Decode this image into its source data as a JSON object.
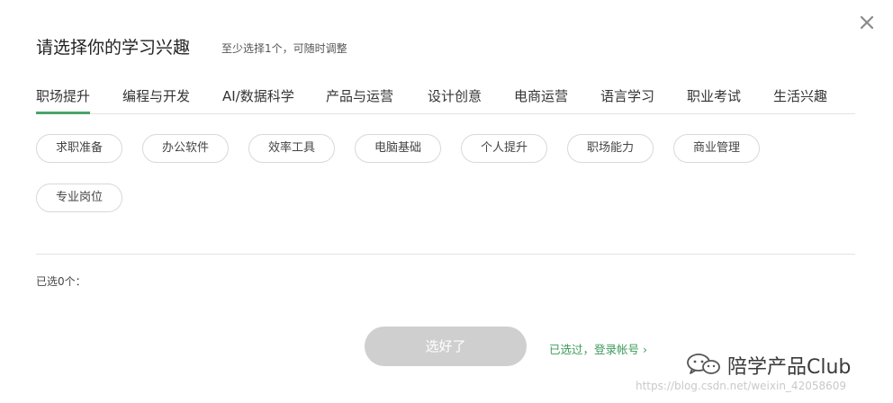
{
  "modal": {
    "title": "请选择你的学习兴趣",
    "subtitle": "至少选择1个，可随时调整",
    "close_icon": "close-icon"
  },
  "tabs": [
    {
      "label": "职场提升",
      "active": true
    },
    {
      "label": "编程与开发",
      "active": false
    },
    {
      "label": "AI/数据科学",
      "active": false
    },
    {
      "label": "产品与运营",
      "active": false
    },
    {
      "label": "设计创意",
      "active": false
    },
    {
      "label": "电商运营",
      "active": false
    },
    {
      "label": "语言学习",
      "active": false
    },
    {
      "label": "职业考试",
      "active": false
    },
    {
      "label": "生活兴趣",
      "active": false
    }
  ],
  "interests": [
    {
      "label": "求职准备"
    },
    {
      "label": "办公软件"
    },
    {
      "label": "效率工具"
    },
    {
      "label": "电脑基础"
    },
    {
      "label": "个人提升"
    },
    {
      "label": "职场能力"
    },
    {
      "label": "商业管理"
    },
    {
      "label": "专业岗位"
    }
  ],
  "selected_label": "已选0个：",
  "confirm_label": "选好了",
  "login_link": "已选过，登录帐号 ›",
  "watermark": {
    "icon": "wechat-icon",
    "text": "陪学产品Club",
    "url": "https://blog.csdn.net/weixin_42058609"
  },
  "colors": {
    "accent": "#4aa36b",
    "link": "#3d9a5a",
    "disabled_button": "#cfcfcf",
    "border": "#d8d8d8"
  }
}
